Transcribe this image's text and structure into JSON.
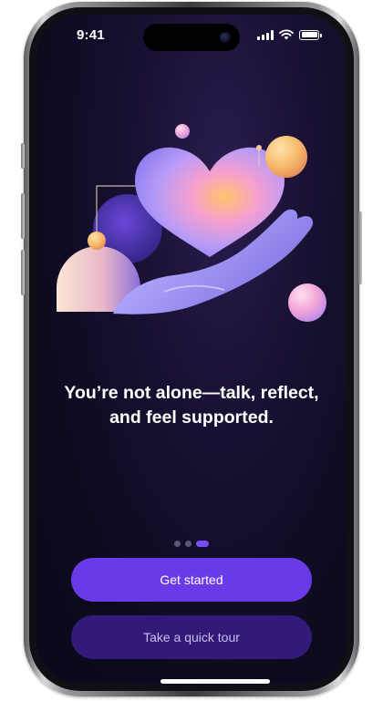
{
  "status_bar": {
    "time": "9:41",
    "icons": [
      "cellular-signal-icon",
      "wifi-icon",
      "battery-icon"
    ]
  },
  "onboarding": {
    "illustration": "heart-in-hand-illustration",
    "headline": "You’re not alone—talk, reflect, and feel supported.",
    "pagination": {
      "total": 3,
      "active": 3
    },
    "primary_button": "Get started",
    "secondary_button": "Take a quick tour"
  },
  "colors": {
    "background": "#0c0a1e",
    "accent": "#6a3ae8",
    "secondary_button": "#321a78",
    "secondary_text": "#c9bdf2",
    "active_dot": "#7c4dff"
  }
}
